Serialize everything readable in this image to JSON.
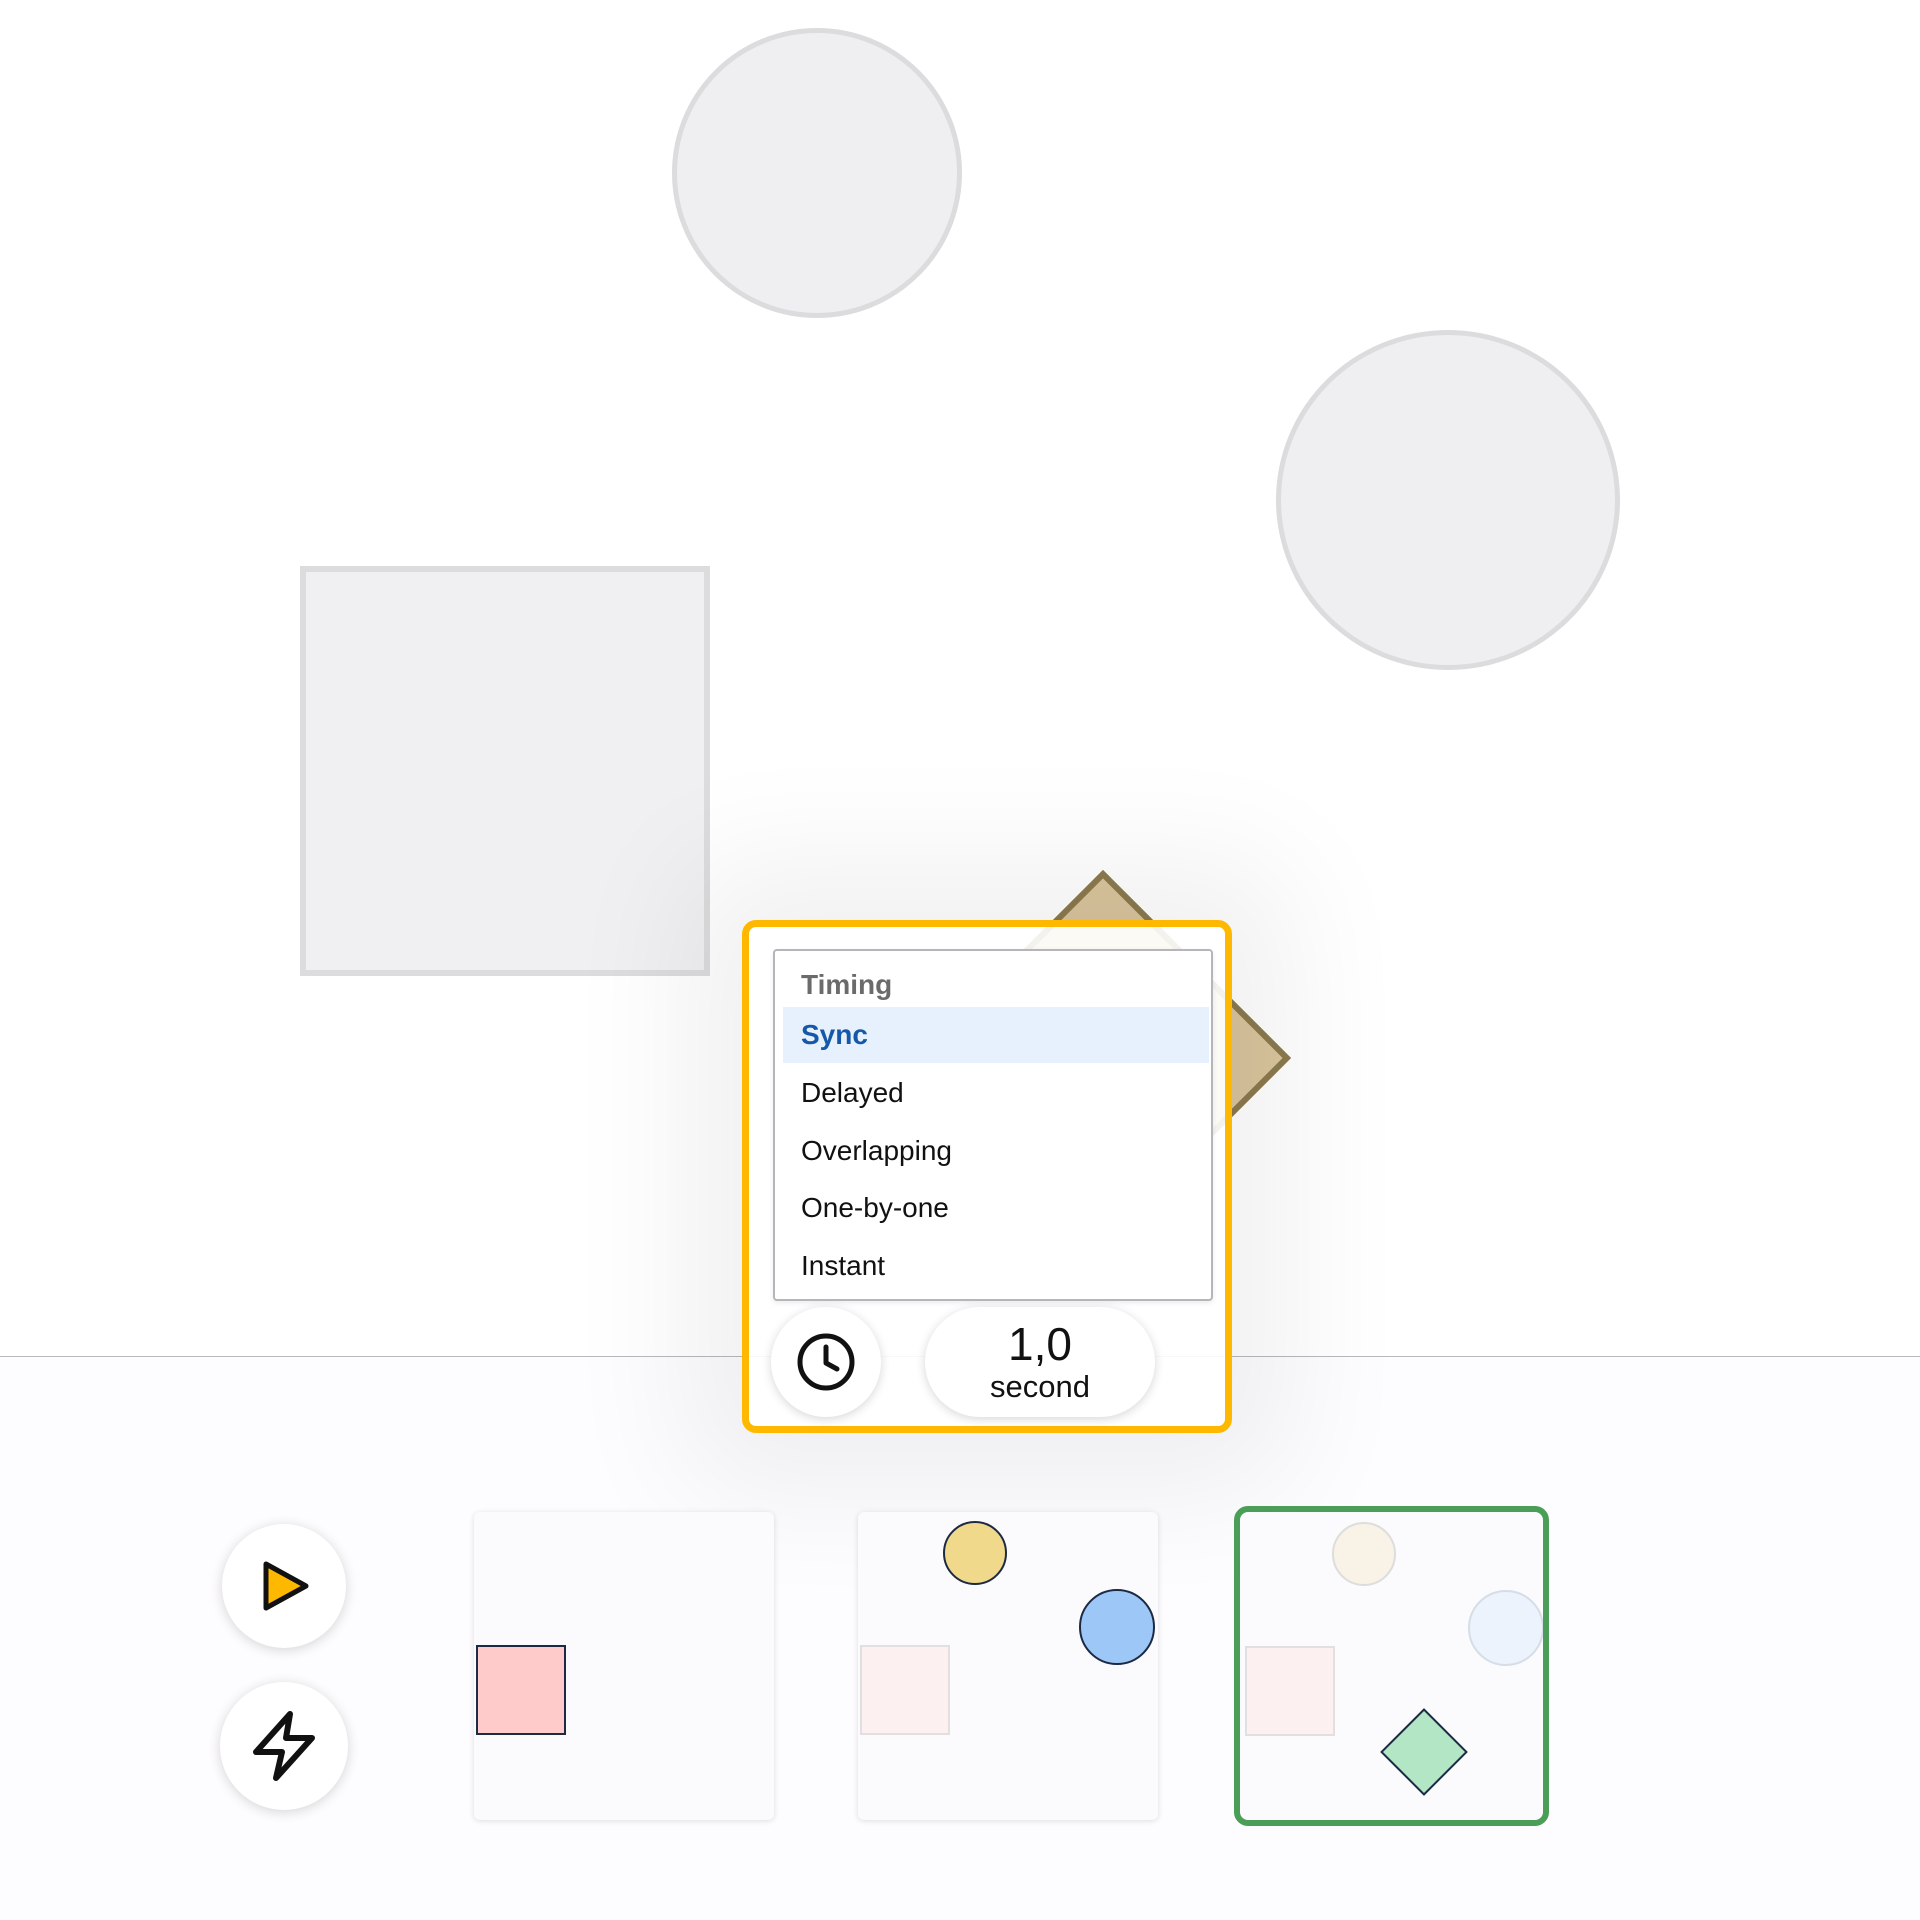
{
  "timing_menu": {
    "header": "Timing",
    "options": [
      {
        "label": "Sync",
        "selected": true
      },
      {
        "label": "Delayed",
        "selected": false
      },
      {
        "label": "Overlapping",
        "selected": false
      },
      {
        "label": "One-by-one",
        "selected": false
      },
      {
        "label": "Instant",
        "selected": false
      }
    ]
  },
  "duration": {
    "value": "1,0",
    "unit": "second"
  },
  "icons": {
    "timing": "clock-icon",
    "play": "play-icon",
    "effects": "lightning-icon"
  },
  "colors": {
    "popover_border": "#ffb800",
    "selected_option_bg": "#e7f1fd",
    "selected_option_text": "#1558a8",
    "active_frame_border": "#4b9e57",
    "play_icon_fill": "#ffb800",
    "canvas_diamond_fill": "#d9c59d",
    "frame1_square": "#ffcaca",
    "frame2_circle_yellow": "#f0d98a",
    "frame2_circle_blue": "#9cc7f7",
    "frame3_diamond": "#b3e6c4"
  },
  "frames": [
    {
      "name": "frame-1",
      "active": false
    },
    {
      "name": "frame-2",
      "active": false
    },
    {
      "name": "frame-3",
      "active": true
    }
  ]
}
